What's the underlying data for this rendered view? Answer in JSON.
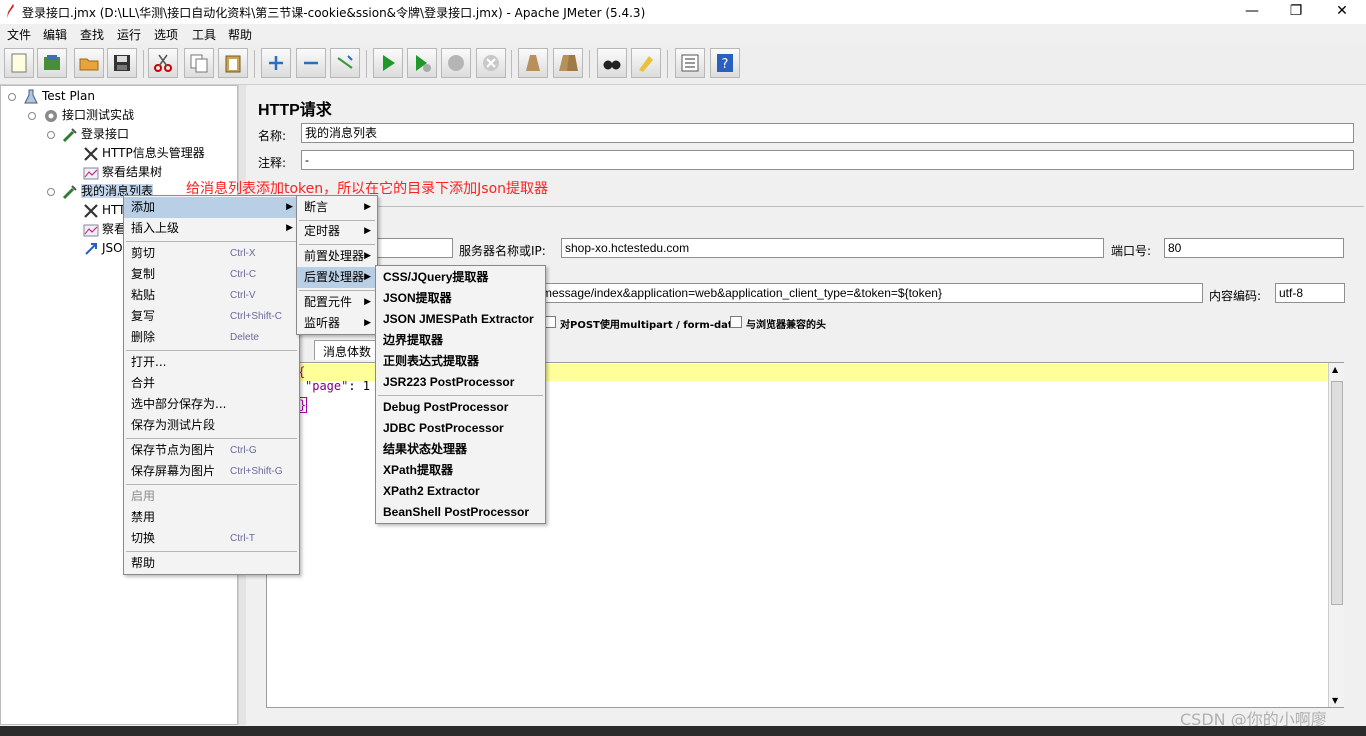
{
  "window": {
    "title": "登录接口.jmx (D:\\LL\\华测\\接口自动化资料\\第三节课-cookie&ssion&令牌\\登录接口.jmx) - Apache JMeter (5.4.3)",
    "minimize": "—",
    "maximize": "❐",
    "close": "✕"
  },
  "menubar": [
    "文件",
    "编辑",
    "查找",
    "运行",
    "选项",
    "工具",
    "帮助"
  ],
  "tree": {
    "nodes": [
      {
        "label": "Test Plan"
      },
      {
        "label": "接口测试实战"
      },
      {
        "label": "登录接口"
      },
      {
        "label": "HTTP信息头管理器"
      },
      {
        "label": "察看结果树"
      },
      {
        "label": "我的消息列表"
      },
      {
        "label": "HTTP"
      },
      {
        "label": "察看"
      },
      {
        "label": "JSO"
      }
    ]
  },
  "panel": {
    "heading": "HTTP请求",
    "name_label": "名称:",
    "name_value": "我的消息列表",
    "comment_label": "注释:",
    "comment_value": "-",
    "server_label": "服务器名称或IP:",
    "server_value": "shop-xo.hctestedu.com",
    "port_label": "端口号:",
    "port_value": "80",
    "path_value": "message/index&application=web&application_client_type=&token=${token}",
    "encoding_label": "内容编码:",
    "encoding_value": "utf-8",
    "multipart_label": "对POST使用multipart / form-data",
    "browser_headers_label": "与浏览器兼容的头",
    "body_tab_label": "消息体数",
    "body_line1": "{",
    "body_key": "\"page\"",
    "body_rest": ": 1",
    "body_line3": "}"
  },
  "annotation": "给消息列表添加token，所以在它的目录下添加Json提取器",
  "context_menu": {
    "items": [
      {
        "label": "添加",
        "submenu": true
      },
      {
        "label": "插入上级",
        "submenu": true
      },
      {
        "label": "剪切",
        "shortcut": "Ctrl-X"
      },
      {
        "label": "复制",
        "shortcut": "Ctrl-C"
      },
      {
        "label": "粘贴",
        "shortcut": "Ctrl-V"
      },
      {
        "label": "复写",
        "shortcut": "Ctrl+Shift-C"
      },
      {
        "label": "删除",
        "shortcut": "Delete"
      },
      {
        "label": "打开..."
      },
      {
        "label": "合并"
      },
      {
        "label": "选中部分保存为..."
      },
      {
        "label": "保存为测试片段"
      },
      {
        "label": "保存节点为图片",
        "shortcut": "Ctrl-G"
      },
      {
        "label": "保存屏幕为图片",
        "shortcut": "Ctrl+Shift-G"
      },
      {
        "label": "启用"
      },
      {
        "label": "禁用"
      },
      {
        "label": "切换",
        "shortcut": "Ctrl-T"
      },
      {
        "label": "帮助"
      }
    ]
  },
  "add_submenu": {
    "items": [
      "断言",
      "定时器",
      "前置处理器",
      "后置处理器",
      "配置元件",
      "监听器"
    ]
  },
  "post_submenu": {
    "items": [
      "CSS/JQuery提取器",
      "JSON提取器",
      "JSON JMESPath Extractor",
      "边界提取器",
      "正则表达式提取器",
      "JSR223 PostProcessor",
      "Debug PostProcessor",
      "JDBC PostProcessor",
      "结果状态处理器",
      "XPath提取器",
      "XPath2 Extractor",
      "BeanShell PostProcessor"
    ]
  },
  "watermark": "CSDN @你的小啊廖",
  "colors": {
    "annotation": "#ff2020",
    "menu_highlight": "#b8cfe5",
    "editor_highlight": "#ffff99"
  }
}
